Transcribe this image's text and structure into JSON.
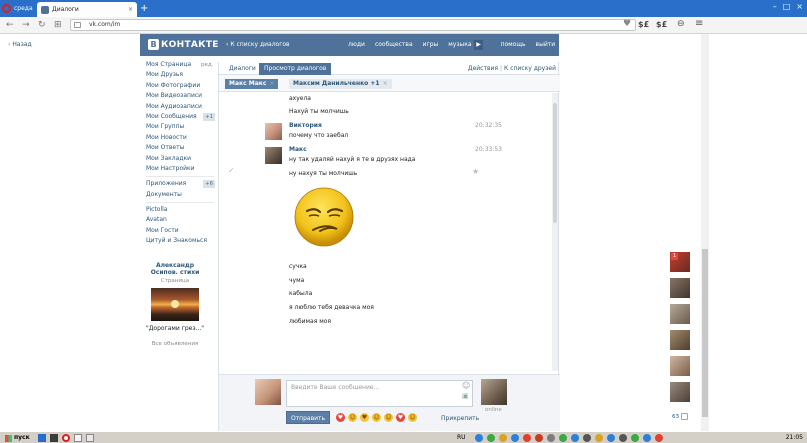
{
  "browser": {
    "menu_label": "среда",
    "tab_title": "Диалоги",
    "tab_close": "×",
    "new_tab": "+",
    "url": "vk.com/im",
    "ext1": "$£",
    "ext2": "$£"
  },
  "page": {
    "back_label": "Назад"
  },
  "vk_header": {
    "logo_letter": "В",
    "logo_text": "КОНТАКТЕ",
    "back_to_list": "К списку диалогов",
    "nav": [
      "люди",
      "сообщества",
      "игры",
      "музыка",
      "помощь",
      "выйти"
    ]
  },
  "menu": {
    "items": [
      {
        "label": "Моя Страница",
        "extra": "ред."
      },
      {
        "label": "Мои Друзья"
      },
      {
        "label": "Мои Фотографии"
      },
      {
        "label": "Мои Видеозаписи"
      },
      {
        "label": "Мои Аудиозаписи"
      },
      {
        "label": "Мои Сообщения",
        "badge": "+1"
      },
      {
        "label": "Мои Группы"
      },
      {
        "label": "Мои Новости"
      },
      {
        "label": "Мои Ответы"
      },
      {
        "label": "Мои Закладки"
      },
      {
        "label": "Мои Настройки"
      }
    ],
    "apps": {
      "label": "Приложения",
      "badge": "+6"
    },
    "docs": "Документы",
    "extra": [
      "Pictolla",
      "Avatan",
      "Мои Гости",
      "Цитуй и Знакомься"
    ]
  },
  "ad": {
    "title": "Александр Осипов. стихи",
    "subtitle": "Страница",
    "caption": "\"Дорогами грез...\"",
    "all": "Все объявления"
  },
  "dialogs": {
    "tab_dialogs": "Диалоги",
    "tab_view": "Просмотр диалогов",
    "actions": "Действия",
    "to_friends": "К списку друзей",
    "divider": "|",
    "chip1": "Макс Макс",
    "chip2": "Максим Данильченко +1",
    "chip_close": "×"
  },
  "messages": {
    "top1": "ахуела",
    "top2": "Нахуй ты молчишь",
    "m1_author": "Виктория",
    "m1_text": "почему что заебал",
    "m1_time": "20:32:35",
    "m2_author": "Макс",
    "m2_text": "ну так удаляй нахуй я те в друзях нада",
    "m2_time": "20:33:53",
    "m3": "ну нахуя ты молчишь",
    "m4": "сучка",
    "m5": "чума",
    "m6": "кабыла",
    "m7": "я люблю тебя девачка моя",
    "m8": "любимая моя"
  },
  "compose": {
    "placeholder": "Введите Ваше сообщение...",
    "send": "Отправить",
    "attach": "Прикрепить",
    "online": "online"
  },
  "right_panel": {
    "count": "63"
  },
  "taskbar": {
    "start": "пуск",
    "lang": "RU",
    "clock": "21:05"
  }
}
